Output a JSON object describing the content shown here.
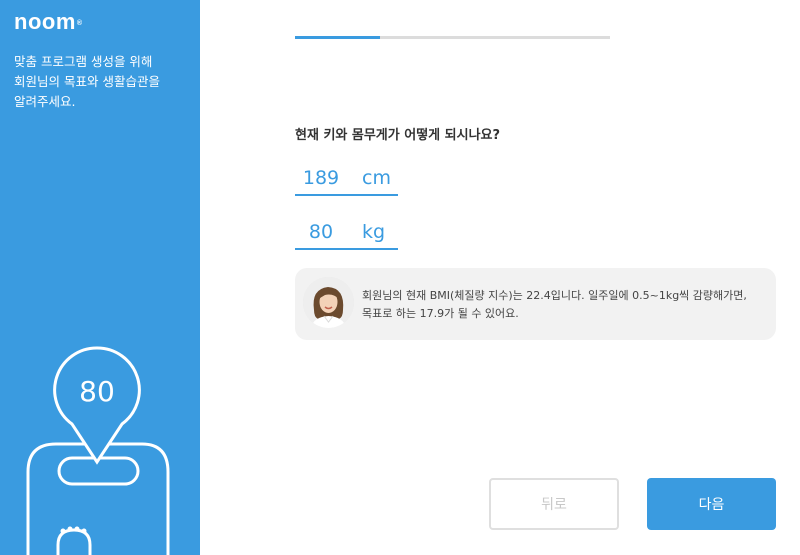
{
  "brand": {
    "logo_text": "noom",
    "logo_mark": "®"
  },
  "sidebar": {
    "description": "맞춤 프로그램 생성을 위해\n회원님의 목표와 생활습관을\n알려주세요.",
    "scale_value": "80"
  },
  "progress": {
    "fraction": 0.27
  },
  "question": "현재 키와 몸무게가 어떻게 되시나요?",
  "height": {
    "value": "189",
    "unit": "cm"
  },
  "weight": {
    "value": "80",
    "unit": "kg"
  },
  "coach": {
    "avatar_icon": "coach-avatar-icon",
    "message": "회원님의 현재 BMI(체질량 지수)는 22.4입니다. 일주일에 0.5~1kg씩 감량해가면,\n목표로 하는 17.9가 될 수 있어요."
  },
  "buttons": {
    "back_label": "뒤로",
    "next_label": "다음"
  },
  "colors": {
    "accent": "#3a9be0",
    "track": "#dcdcdc",
    "panel": "#f2f2f2"
  }
}
